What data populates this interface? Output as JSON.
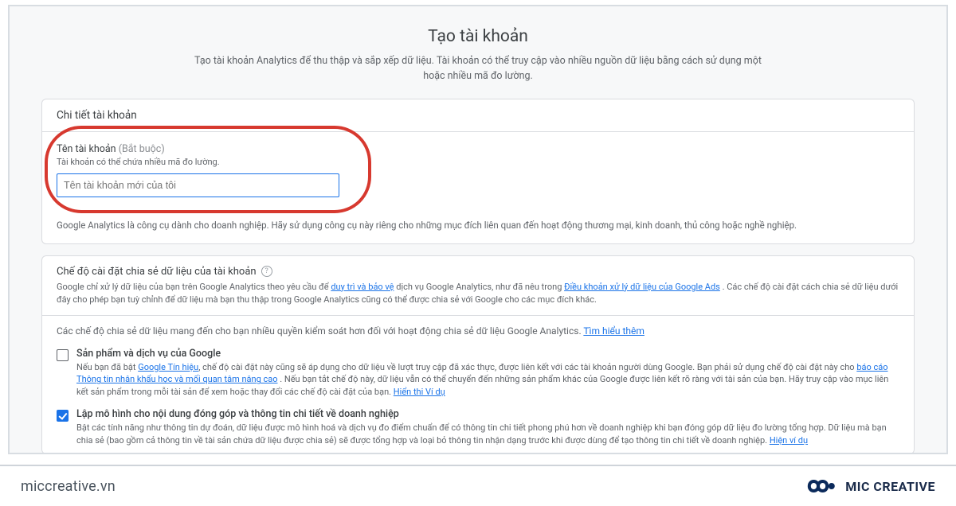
{
  "page": {
    "title": "Tạo tài khoản",
    "subtitle": "Tạo tài khoản Analytics để thu thập và sắp xếp dữ liệu. Tài khoản có thể truy cập vào nhiều nguồn dữ liệu bằng cách sử dụng một hoặc nhiều mã đo lường."
  },
  "account_details": {
    "header": "Chi tiết tài khoản",
    "name_label": "Tên tài khoản",
    "required": "(Bắt buộc)",
    "name_help": "Tài khoản có thể chứa nhiều mã đo lường.",
    "name_placeholder": "Tên tài khoản mới của tôi",
    "business_note": "Google Analytics là công cụ dành cho doanh nghiệp. Hãy sử dụng công cụ này riêng cho những mục đích liên quan đến hoạt động thương mại, kinh doanh, thủ công hoặc nghề nghiệp."
  },
  "sharing": {
    "title": "Chế độ cài đặt chia sẻ dữ liệu của tài khoản",
    "desc_prefix": "Google chỉ xử lý dữ liệu của bạn trên Google Analytics theo yêu cầu để ",
    "link1": "duy trì và bảo vệ",
    "desc_mid": " dịch vụ Google Analytics, như đã nêu trong ",
    "link2": "Điều khoản xử lý dữ liệu của Google Ads",
    "desc_suffix": " . Các chế độ cài đặt cách chia sẻ dữ liệu dưới đây cho phép bạn tuỳ chỉnh để dữ liệu mà bạn thu thập trong Google Analytics cũng có thể được chia sẻ với Google cho các mục đích khác.",
    "control_note": "Các chế độ chia sẻ dữ liệu mang đến cho bạn nhiều quyền kiểm soát hơn đối với hoạt động chia sẻ dữ liệu Google Analytics. ",
    "learn_more": "Tìm hiểu thêm"
  },
  "options": [
    {
      "checked": false,
      "title": "Sản phẩm và dịch vụ của Google",
      "d1": "Nếu bạn đã bật ",
      "l1": "Google Tín hiệu",
      "d2": ", chế độ cài đặt này cũng sẽ áp dụng cho dữ liệu về lượt truy cập đã xác thực, được liên kết với các tài khoản người dùng Google. Bạn phải sử dụng chế độ cài đặt này cho ",
      "l2": "báo cáo Thông tin nhân khẩu học và mối quan tâm nâng cao",
      "d3": " . Nếu bạn tắt chế độ này, dữ liệu vẫn có thể chuyển đến những sản phẩm khác của Google được liên kết rõ ràng với tài sản của bạn. Hãy truy cập vào mục liên kết sản phẩm trong mỗi tài sản để xem hoặc thay đổi các chế độ cài đặt của bạn.",
      "l3": "Hiển thị Ví dụ"
    },
    {
      "checked": true,
      "title": "Lập mô hình cho nội dung đóng góp và thông tin chi tiết về doanh nghiệp",
      "d1": "Bật các tính năng như thông tin dự đoán, dữ liệu được mô hình hoá và dịch vụ đo điểm chuẩn để có thông tin chi tiết phong phú hơn về doanh nghiệp khi bạn đóng góp dữ liệu đo lường tổng hợp. Dữ liệu mà bạn chia sẻ (bao gồm cả thông tin về tài sản chứa dữ liệu được chia sẻ) sẽ được tổng hợp và loại bỏ thông tin nhận dạng trước khi được dùng để tạo thông tin chi tiết về doanh nghiệp. ",
      "l1": "Hiện ví dụ"
    }
  ],
  "footer": {
    "domain": "miccreative.vn",
    "brand": "MIC CREATIVE"
  }
}
